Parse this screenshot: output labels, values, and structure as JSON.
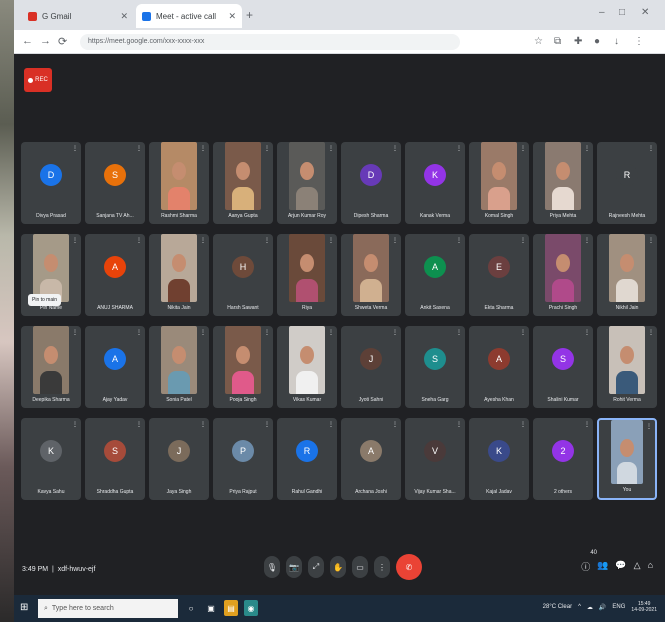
{
  "browser": {
    "tabs": [
      {
        "label": "G Gmail",
        "favicon_color": "#d93025"
      },
      {
        "label": "Meet - active call",
        "favicon_color": "#1a73e8"
      }
    ],
    "new_tab_label": "+",
    "window_controls": [
      "–",
      "□",
      "✕"
    ],
    "url": "https://meet.google.com/xxx-xxxx-xxx",
    "nav_icons": [
      "←",
      "→",
      "⟳"
    ]
  },
  "meet": {
    "rec_label": "REC",
    "meeting_time": "3:49 PM",
    "meeting_code": "xdf-hwuv-ejf",
    "participants_badge": "40",
    "pin_tooltip": "Pin to main",
    "participants": [
      {
        "name": "Divya Prasad",
        "type": "avatar",
        "initial": "D",
        "color": "#1a73e8"
      },
      {
        "name": "Sanjana TV Ah...",
        "type": "avatar",
        "initial": "S",
        "color": "#e8710a"
      },
      {
        "name": "Rashmi Sharma",
        "type": "video",
        "bg": "#b58a66",
        "shirt": "#e3826b"
      },
      {
        "name": "Aanya Gupta",
        "type": "video",
        "bg": "#7a5a4a",
        "shirt": "#d8b07a"
      },
      {
        "name": "Arjun Kumar Roy",
        "type": "video",
        "bg": "#5a5a58",
        "shirt": "#8b8177"
      },
      {
        "name": "Dipesh Sharma",
        "type": "avatar",
        "initial": "D",
        "color": "#673ab7"
      },
      {
        "name": "Kanak Verma",
        "type": "avatar",
        "initial": "K",
        "color": "#9334e6"
      },
      {
        "name": "Komal Singh",
        "type": "video",
        "bg": "#9a7a68",
        "shirt": "#d9a08c"
      },
      {
        "name": "Priya Mehta",
        "type": "video",
        "bg": "#8a7a70",
        "shirt": "#e6d9d0"
      },
      {
        "name": "Rajneesh Mehta",
        "type": "avatar",
        "initial": "R",
        "color": "#3c4043"
      },
      {
        "name": "Pin Name",
        "type": "video",
        "bg": "#a59a88",
        "shirt": "#c8b8a8"
      },
      {
        "name": "ANUJ SHARMA",
        "type": "avatar",
        "initial": "A",
        "color": "#e8430a"
      },
      {
        "name": "Nikita Jain",
        "type": "video",
        "bg": "#b8a898",
        "shirt": "#704030"
      },
      {
        "name": "Harsh Sawant",
        "type": "avatar",
        "initial": "H",
        "color": "#6e4a3a"
      },
      {
        "name": "Riya",
        "type": "video",
        "bg": "#6a4a3a",
        "shirt": "#b05070"
      },
      {
        "name": "Shweta Verma",
        "type": "video",
        "bg": "#8a6a5a",
        "shirt": "#d0b090"
      },
      {
        "name": "Ankit Saxena",
        "type": "avatar",
        "initial": "A",
        "color": "#0d904f"
      },
      {
        "name": "Ekta Sharma",
        "type": "avatar",
        "initial": "E",
        "color": "#6b3f3f"
      },
      {
        "name": "Prachi Singh",
        "type": "video",
        "bg": "#7a4a6a",
        "shirt": "#b04a8a"
      },
      {
        "name": "Nikhil Jain",
        "type": "video",
        "bg": "#a09080",
        "shirt": "#e0d8d0"
      },
      {
        "name": "Deepika Sharma",
        "type": "video",
        "bg": "#8a7a6a",
        "shirt": "#3a3a3a"
      },
      {
        "name": "Ajay Yadav",
        "type": "avatar",
        "initial": "A",
        "color": "#1a73e8"
      },
      {
        "name": "Sonia Patel",
        "type": "video",
        "bg": "#9a8a7a",
        "shirt": "#6a9ab0"
      },
      {
        "name": "Pooja Singh",
        "type": "video",
        "bg": "#7a5a4a",
        "shirt": "#e05a8a"
      },
      {
        "name": "Vikas Kumar",
        "type": "video",
        "bg": "#d0ccc8",
        "shirt": "#f0f0f0"
      },
      {
        "name": "Jyoti Sahni",
        "type": "avatar",
        "initial": "J",
        "color": "#5d4037"
      },
      {
        "name": "Sneha Garg",
        "type": "avatar",
        "initial": "S",
        "color": "#1e8e8e"
      },
      {
        "name": "Ayesha Khan",
        "type": "avatar",
        "initial": "A",
        "color": "#8d3b2f"
      },
      {
        "name": "Shalini Kumar",
        "type": "avatar",
        "initial": "S",
        "color": "#9334e6"
      },
      {
        "name": "Rohit Verma",
        "type": "video",
        "bg": "#c8c0b8",
        "shirt": "#3a5a7a"
      },
      {
        "name": "Kavya Sahu",
        "type": "avatar",
        "initial": "K",
        "color": "#5f6368"
      },
      {
        "name": "Shraddha Gupta",
        "type": "avatar",
        "initial": "S",
        "color": "#a64b3a"
      },
      {
        "name": "Jaya Singh",
        "type": "avatar",
        "initial": "J",
        "color": "#7b6b5b"
      },
      {
        "name": "Priya Rajput",
        "type": "avatar",
        "initial": "P",
        "color": "#6b8aa8"
      },
      {
        "name": "Rahul Gandhi",
        "type": "avatar",
        "initial": "R",
        "color": "#1a73e8"
      },
      {
        "name": "Archana Joshi",
        "type": "avatar",
        "initial": "A",
        "color": "#8a7a6a"
      },
      {
        "name": "Vijay Kumar Sha...",
        "type": "avatar",
        "initial": "V",
        "color": "#4a3a3a"
      },
      {
        "name": "Kajal Jadav",
        "type": "avatar",
        "initial": "K",
        "color": "#3a4a8a"
      },
      {
        "name": "2 others",
        "type": "group",
        "initial": "2",
        "color": "#9334e6"
      },
      {
        "name": "You",
        "type": "video",
        "bg": "#8aa0b8",
        "shirt": "#d0d8e0",
        "selected": true
      }
    ],
    "controls": [
      "🎙",
      "📷",
      "⤢",
      "✋",
      "▭",
      "⋮",
      "✆"
    ],
    "right_controls": [
      "ⓘ",
      "👥",
      "💬",
      "△",
      "⌂"
    ]
  },
  "taskbar": {
    "start_icon": "⊞",
    "search_placeholder": "Type here to search",
    "apps": [
      {
        "icon": "○",
        "color": "#1b2a3a"
      },
      {
        "icon": "▣",
        "color": "#1b2a3a"
      },
      {
        "icon": "▤",
        "color": "#e0a020"
      },
      {
        "icon": "◉",
        "color": "#2a8a8a"
      }
    ],
    "weather": "28°C Clear",
    "tray_icons": [
      "^",
      "☁",
      "🔊",
      "ENG"
    ],
    "time": "15:49",
    "date": "14-09-2021"
  }
}
